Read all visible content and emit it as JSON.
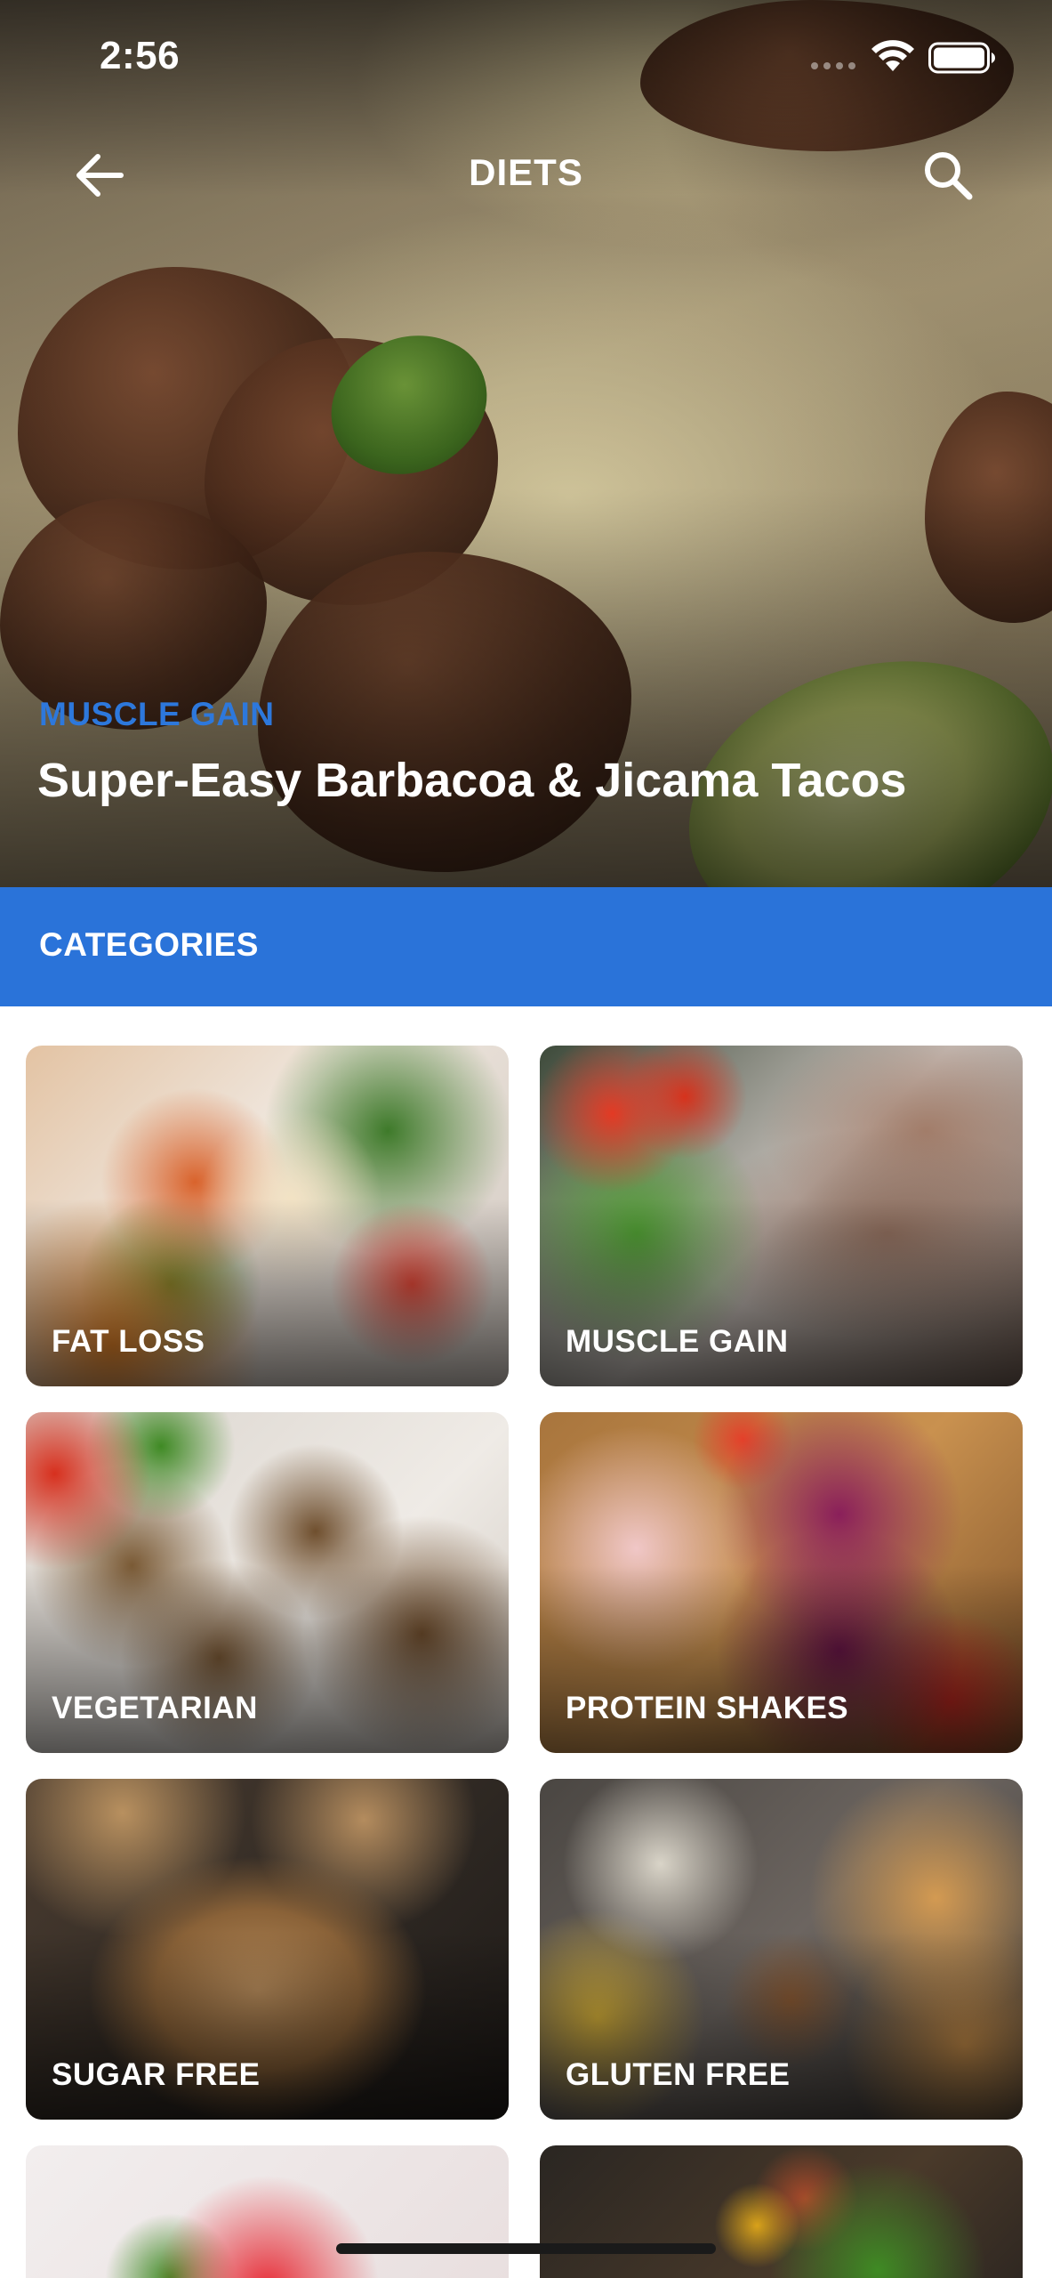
{
  "status_bar": {
    "time": "2:56"
  },
  "nav": {
    "title": "DIETS",
    "back_icon": "arrow-left-icon",
    "search_icon": "search-icon"
  },
  "hero": {
    "category": "MUSCLE GAIN",
    "title": "Super-Easy Barbacoa & Jicama Tacos"
  },
  "categories_header": "CATEGORIES",
  "categories": [
    {
      "label": "FAT LOSS"
    },
    {
      "label": "MUSCLE GAIN"
    },
    {
      "label": "VEGETARIAN"
    },
    {
      "label": "PROTEIN SHAKES"
    },
    {
      "label": "SUGAR FREE"
    },
    {
      "label": "GLUTEN FREE"
    }
  ],
  "colors": {
    "accent": "#2a73d9",
    "hero_category": "#2d78dc",
    "text_on_dark": "#ffffff"
  }
}
